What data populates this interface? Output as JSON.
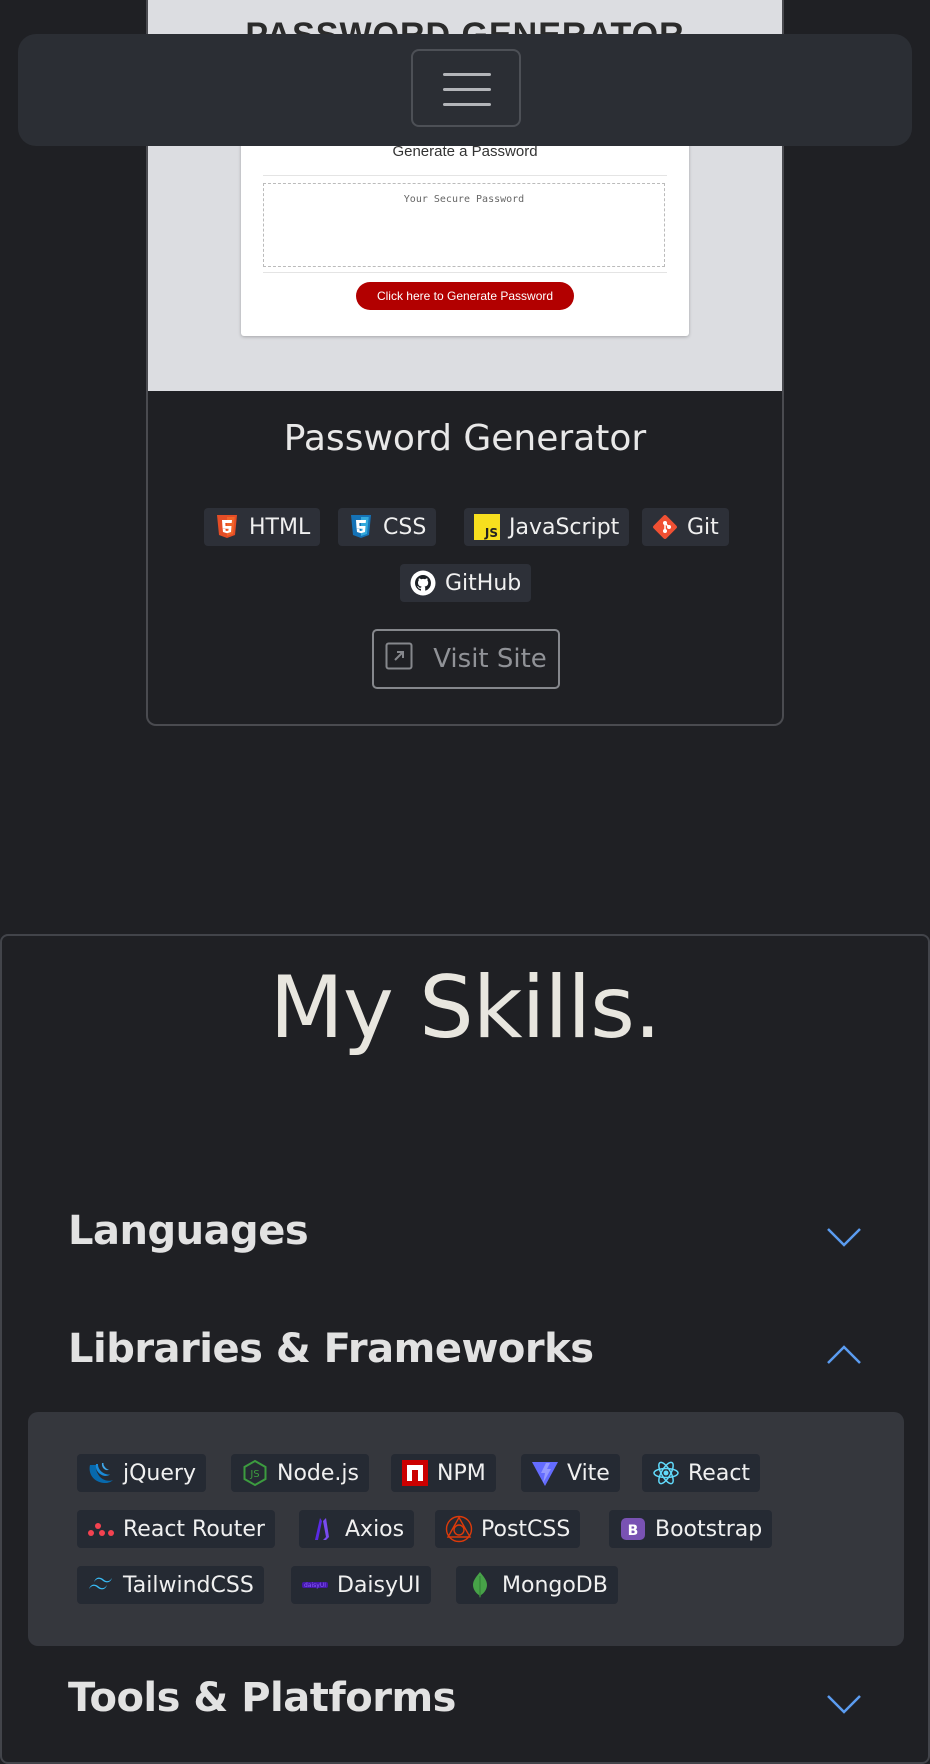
{
  "project": {
    "preview": {
      "heading": "PASSWORD GENERATOR",
      "subtitle": "Generate a Password",
      "placeholder": "Your Secure Password",
      "button": "Click here to Generate Password"
    },
    "title": "Password Generator",
    "tech": [
      {
        "label": "HTML",
        "icon": "html5-icon"
      },
      {
        "label": "CSS",
        "icon": "css3-icon"
      },
      {
        "label": "JavaScript",
        "icon": "javascript-icon"
      },
      {
        "label": "Git",
        "icon": "git-icon"
      },
      {
        "label": "GitHub",
        "icon": "github-icon"
      }
    ],
    "visit_label": "Visit Site"
  },
  "skills": {
    "title": "My Skills.",
    "categories": [
      {
        "title": "Languages",
        "expanded": false
      },
      {
        "title": "Libraries & Frameworks",
        "expanded": true
      },
      {
        "title": "Tools & Platforms",
        "expanded": false
      }
    ],
    "libraries": [
      {
        "label": "jQuery",
        "icon": "jquery-icon"
      },
      {
        "label": "Node.js",
        "icon": "nodejs-icon"
      },
      {
        "label": "NPM",
        "icon": "npm-icon"
      },
      {
        "label": "Vite",
        "icon": "vite-icon"
      },
      {
        "label": "React",
        "icon": "react-icon"
      },
      {
        "label": "React Router",
        "icon": "react-router-icon"
      },
      {
        "label": "Axios",
        "icon": "axios-icon"
      },
      {
        "label": "PostCSS",
        "icon": "postcss-icon"
      },
      {
        "label": "Bootstrap",
        "icon": "bootstrap-icon"
      },
      {
        "label": "TailwindCSS",
        "icon": "tailwindcss-icon"
      },
      {
        "label": "DaisyUI",
        "icon": "daisyui-icon"
      },
      {
        "label": "MongoDB",
        "icon": "mongodb-icon"
      }
    ]
  },
  "colors": {
    "background": "#1f2024",
    "accent": "#5b9cf0",
    "preview_button": "#b20000"
  }
}
